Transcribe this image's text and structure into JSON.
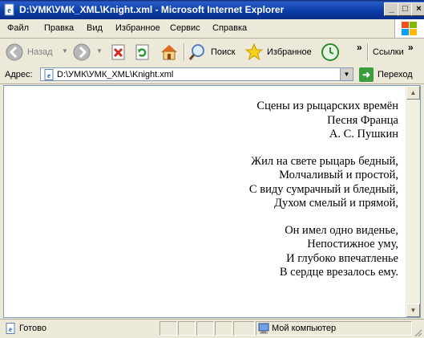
{
  "window": {
    "title": "D:\\УМК\\УМК_XML\\Knight.xml - Microsoft Internet Explorer"
  },
  "title_buttons": {
    "minimize": "_",
    "maximize": "□",
    "close": "×"
  },
  "menu": [
    {
      "label": "Файл"
    },
    {
      "label": "Правка"
    },
    {
      "label": "Вид"
    },
    {
      "label": "Избранное"
    },
    {
      "label": "Сервис"
    },
    {
      "label": "Справка"
    }
  ],
  "toolbar": {
    "back_label": "Назад",
    "search_label": "Поиск",
    "favorites_label": "Избранное",
    "links_label": "Ссылки",
    "chevron": "»"
  },
  "address": {
    "label": "Адрес:",
    "url": "D:\\УМК\\УМК_XML\\Knight.xml",
    "go_label": "Переход"
  },
  "poem": {
    "header": [
      "Сцены из рыцарских времён",
      "Песня Франца",
      "А. С. Пушкин"
    ],
    "stanza1": [
      "Жил на свете рыцарь бедный,",
      "Молчаливый и простой,",
      "С виду сумрачный и бледный,",
      "Духом смелый и прямой,"
    ],
    "stanza2": [
      "Он имел одно виденье,",
      "Непостижное уму,",
      "И глубоко впечатленье",
      "В сердце врезалось ему."
    ]
  },
  "status": {
    "text": "Готово",
    "zone": "Мой компьютер"
  },
  "colors": {
    "title_bar": "#0b3ea8",
    "chrome": "#ece9d8",
    "go_button": "#3b9d3b"
  }
}
